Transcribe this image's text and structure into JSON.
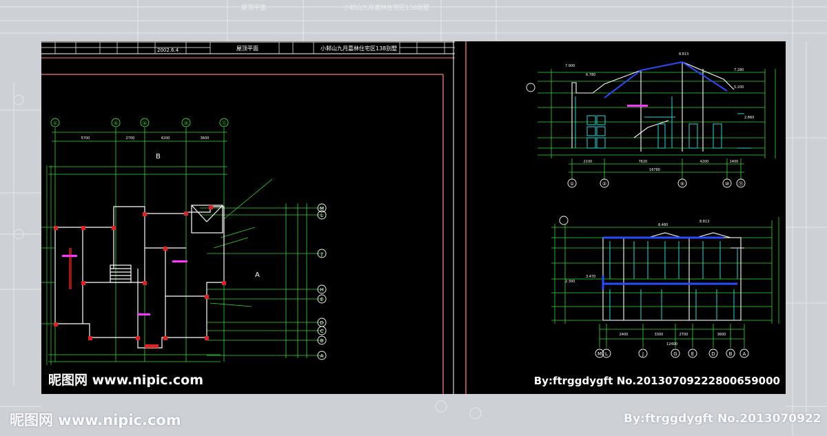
{
  "title_block": {
    "drawing_name": "屋顶平面",
    "project_name": "小邾山九月嘉林住宅区138别墅",
    "date": "2002.6.4"
  },
  "plan": {
    "axis_top": [
      "①",
      "④",
      "④",
      "③",
      "⑪"
    ],
    "axis_right": [
      "M",
      "L",
      "J",
      "H",
      "E",
      "D",
      "C",
      "B",
      "A"
    ],
    "dims_top": [
      "5700",
      "2700",
      "4200",
      "3600"
    ],
    "section_marks": [
      "B",
      "A"
    ]
  },
  "elevation_top": {
    "levels": [
      "8.813",
      "7.900",
      "7.280",
      "6.780",
      "5.200",
      "2.860"
    ],
    "axis": [
      "①",
      "②",
      "⑤",
      "⑩",
      "⑪"
    ],
    "dims": [
      "2100",
      "7620",
      "4200",
      "1400",
      "16780"
    ]
  },
  "elevation_bottom": {
    "levels": [
      "8.813",
      "8.480",
      "2.300",
      "3.470"
    ],
    "axis": [
      "M",
      "L",
      "J",
      "G",
      "E",
      "D",
      "B",
      "A"
    ],
    "dims": [
      "2400",
      "3300",
      "2700",
      "3600",
      "12400"
    ]
  },
  "watermarks": {
    "site_left": "昵图网 www.nipic.com",
    "credit_right": "By:ftrggdygft  No.20130709222800659000",
    "outer_left": "昵图网 www.nipic.com",
    "outer_right": "By:ftrggdygft  No.2013070922"
  },
  "colors": {
    "cad_green": "#33dd33",
    "cad_white": "#ffffff",
    "cad_red": "#dd2222",
    "cad_cyan": "#22dddd",
    "cad_blue": "#2a4cff",
    "cad_magenta": "#ff33ff",
    "border_pink": "#ff7a7a"
  }
}
